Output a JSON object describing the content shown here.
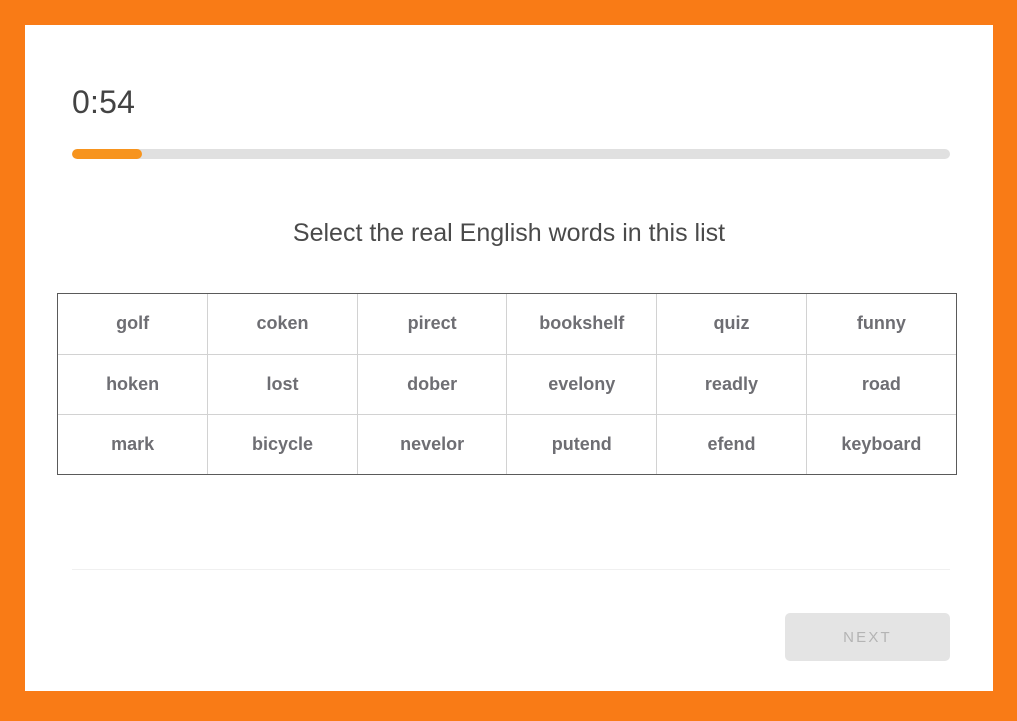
{
  "theme": {
    "frame_color": "#F97B16",
    "card_color": "#FFFFFF",
    "accent_color": "#F7941E",
    "track_color": "#E0E0E0",
    "text_color": "#4A4A4A",
    "word_color": "#6E6E73",
    "grid_outer_border": "#5A5A5A",
    "grid_inner_border": "#D2D2D2",
    "divider_color": "#F0F0F0",
    "button_bg": "#E4E4E4",
    "button_text": "#B4B4B4"
  },
  "timer": {
    "value": "0:54"
  },
  "progress": {
    "percent": 8
  },
  "prompt": {
    "text": "Select the real English words in this list"
  },
  "grid": {
    "columns": 6,
    "rows": [
      [
        "golf",
        "coken",
        "pirect",
        "bookshelf",
        "quiz",
        "funny"
      ],
      [
        "hoken",
        "lost",
        "dober",
        "evelony",
        "readly",
        "road"
      ],
      [
        "mark",
        "bicycle",
        "nevelor",
        "putend",
        "efend",
        "keyboard"
      ]
    ]
  },
  "footer": {
    "next_label": "Next"
  }
}
